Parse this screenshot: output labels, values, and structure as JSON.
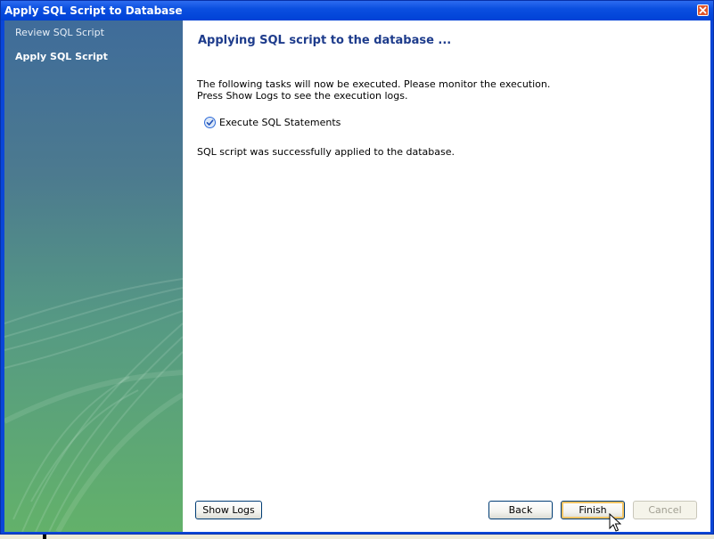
{
  "window": {
    "title": "Apply SQL Script to Database"
  },
  "sidebar": {
    "items": [
      {
        "label": "Review SQL Script",
        "active": false
      },
      {
        "label": "Apply SQL Script",
        "active": true
      }
    ]
  },
  "main": {
    "heading": "Applying SQL script to the database ...",
    "description_line1": "The following tasks will now be executed. Please monitor the execution.",
    "description_line2": "Press Show Logs to see the execution logs.",
    "tasks": [
      {
        "label": "Execute SQL Statements",
        "done": true
      }
    ],
    "status": "SQL script was successfully applied to the database."
  },
  "buttons": {
    "show_logs": "Show Logs",
    "back": "Back",
    "finish": "Finish",
    "cancel": "Cancel"
  },
  "colors": {
    "titlebar": "#0b4fe0",
    "heading": "#1e3c8c",
    "check": "#2e6bd8"
  }
}
